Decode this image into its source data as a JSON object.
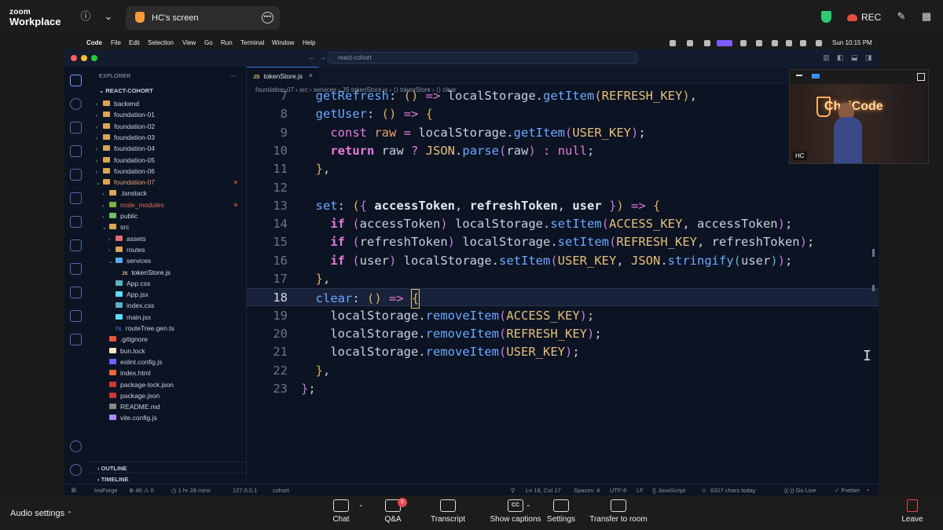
{
  "zoom": {
    "brand_line1": "zoom",
    "brand_line2": "Workplace",
    "share_tab_label": "HC's screen",
    "rec_label": "REC",
    "audio_settings": "Audio settings",
    "controls": [
      {
        "label": "Chat",
        "icon": "chat-icon"
      },
      {
        "label": "Q&A",
        "icon": "qa-icon",
        "badge": "5"
      },
      {
        "label": "Transcript",
        "icon": "transcript-icon"
      },
      {
        "label": "Show captions",
        "icon": "captions-icon",
        "icon_text": "CC"
      },
      {
        "label": "Settings",
        "icon": "gear-icon"
      },
      {
        "label": "Transfer to room",
        "icon": "transfer-icon"
      }
    ],
    "leave_label": "Leave"
  },
  "macbar": {
    "app": "Code",
    "menus": [
      "File",
      "Edit",
      "Selection",
      "View",
      "Go",
      "Run",
      "Terminal",
      "Window",
      "Help"
    ],
    "clock": "Sun 10:15 PM"
  },
  "vscode": {
    "command_center": "react-cohort",
    "explorer_title": "EXPLORER",
    "root": "REACT-COHORT",
    "tree": [
      {
        "label": "backend",
        "depth": 1,
        "type": "folder",
        "chev": "›"
      },
      {
        "label": "foundation-01",
        "depth": 1,
        "type": "folder",
        "chev": "›"
      },
      {
        "label": "foundation-02",
        "depth": 1,
        "type": "folder",
        "chev": "›"
      },
      {
        "label": "foundation-03",
        "depth": 1,
        "type": "folder",
        "chev": "›"
      },
      {
        "label": "foundation-04",
        "depth": 1,
        "type": "folder",
        "chev": "›"
      },
      {
        "label": "foundation-05",
        "depth": 1,
        "type": "folder",
        "chev": "›"
      },
      {
        "label": "foundation-06",
        "depth": 1,
        "type": "folder",
        "chev": "›"
      },
      {
        "label": "foundation-07",
        "depth": 1,
        "type": "folder-open",
        "chev": "⌄",
        "modified": true
      },
      {
        "label": ".tanstack",
        "depth": 2,
        "type": "folder",
        "chev": "›"
      },
      {
        "label": "node_modules",
        "depth": 2,
        "type": "folder-node",
        "chev": "›",
        "modified": true
      },
      {
        "label": "public",
        "depth": 2,
        "type": "folder-public",
        "chev": "›"
      },
      {
        "label": "src",
        "depth": 2,
        "type": "folder-open",
        "chev": "⌄"
      },
      {
        "label": "assets",
        "depth": 3,
        "type": "folder-assets",
        "chev": "›"
      },
      {
        "label": "routes",
        "depth": 3,
        "type": "folder-routes",
        "chev": "›"
      },
      {
        "label": "services",
        "depth": 3,
        "type": "folder-services",
        "chev": "⌄"
      },
      {
        "label": "tokenStore.js",
        "depth": 4,
        "type": "file-js",
        "icon_text": "JS"
      },
      {
        "label": "App.css",
        "depth": 3,
        "type": "file-css"
      },
      {
        "label": "App.jsx",
        "depth": 3,
        "type": "file-jsx"
      },
      {
        "label": "index.css",
        "depth": 3,
        "type": "file-css"
      },
      {
        "label": "main.jsx",
        "depth": 3,
        "type": "file-jsx"
      },
      {
        "label": "routeTree.gen.ts",
        "depth": 3,
        "type": "file-ts",
        "icon_text": "TS"
      },
      {
        "label": ".gitignore",
        "depth": 2,
        "type": "file-git"
      },
      {
        "label": "bun.lock",
        "depth": 2,
        "type": "file-bun"
      },
      {
        "label": "eslint.config.js",
        "depth": 2,
        "type": "file-eslint"
      },
      {
        "label": "index.html",
        "depth": 2,
        "type": "file-html"
      },
      {
        "label": "package-lock.json",
        "depth": 2,
        "type": "file-npm"
      },
      {
        "label": "package.json",
        "depth": 2,
        "type": "file-npm"
      },
      {
        "label": "README.md",
        "depth": 2,
        "type": "file-md"
      },
      {
        "label": "vite.config.js",
        "depth": 2,
        "type": "file-vite"
      }
    ],
    "outline": "OUTLINE",
    "timeline": "TIMELINE",
    "tab": {
      "label": "tokenStore.js",
      "icon_text": "JS",
      "close": "×"
    },
    "breadcrumb": "foundation-07 › src › services › JS tokenStore.js › ⟨⟩ tokenStore › ⟨⟩ clear",
    "code_lines": [
      {
        "n": "7",
        "html": "  <span class='f'>getRefresh</span><span class='v'>: </span><span class='g1'>()</span><span class='k'> =&gt; </span><span class='v'>localStorage.</span><span class='f'>getItem</span><span class='g1'>(</span><span class='c'>REFRESH_KEY</span><span class='g1'>)</span><span class='v'>,</span>"
      },
      {
        "n": "8",
        "html": "  <span class='f'>getUser</span><span class='v'>: </span><span class='g1'>()</span><span class='k'> =&gt; </span><span class='g1'>{</span>"
      },
      {
        "n": "9",
        "html": "    <span class='k'>const</span><span class='p'> raw </span><span class='k'>= </span><span class='v'>localStorage.</span><span class='f'>getItem</span><span class='g2'>(</span><span class='c'>USER_KEY</span><span class='g2'>)</span><span class='v'>;</span>"
      },
      {
        "n": "10",
        "html": "    <span class='kb'>return</span><span class='v'> raw </span><span class='k'>?</span><span class='c'> JSON</span><span class='v'>.</span><span class='f'>parse</span><span class='g2'>(</span><span class='v'>raw</span><span class='g2'>)</span><span class='k'> : </span><span class='k'>null</span><span class='v'>;</span>"
      },
      {
        "n": "11",
        "html": "  <span class='g1'>}</span><span class='v'>,</span>"
      },
      {
        "n": "12",
        "html": ""
      },
      {
        "n": "13",
        "html": "  <span class='f'>set</span><span class='v'>: </span><span class='g1'>(</span><span class='g2'>{</span><span class='pb'> accessToken</span><span class='v'>, </span><span class='pb'>refreshToken</span><span class='v'>, </span><span class='pb'>user</span><span class='g2'> }</span><span class='g1'>)</span><span class='k'> =&gt; </span><span class='g1'>{</span>"
      },
      {
        "n": "14",
        "html": "    <span class='kb'>if</span><span class='g2'> (</span><span class='v'>accessToken</span><span class='g2'>)</span><span class='v'> localStorage.</span><span class='f'>setItem</span><span class='g2'>(</span><span class='c'>ACCESS_KEY</span><span class='v'>, accessToken</span><span class='g2'>)</span><span class='v'>;</span>"
      },
      {
        "n": "15",
        "html": "    <span class='kb'>if</span><span class='g2'> (</span><span class='v'>refreshToken</span><span class='g2'>)</span><span class='v'> localStorage.</span><span class='f'>setItem</span><span class='g2'>(</span><span class='c'>REFRESH_KEY</span><span class='v'>, refreshToken</span><span class='g2'>)</span><span class='v'>;</span>"
      },
      {
        "n": "16",
        "html": "    <span class='kb'>if</span><span class='g2'> (</span><span class='v'>user</span><span class='g2'>)</span><span class='v'> localStorage.</span><span class='f'>setItem</span><span class='g2'>(</span><span class='c'>USER_KEY</span><span class='v'>, </span><span class='c'>JSON</span><span class='v'>.</span><span class='f'>stringify</span><span class='g3'>(</span><span class='v'>user</span><span class='g3'>)</span><span class='g2'>)</span><span class='v'>;</span>"
      },
      {
        "n": "17",
        "html": "  <span class='g1'>}</span><span class='v'>,</span>"
      },
      {
        "n": "18",
        "html": "  <span class='f'>clear</span><span class='v'>: </span><span class='g1'>()</span><span class='k'> =&gt; </span><span class='g1 cursor-block'>{</span>",
        "current": true
      },
      {
        "n": "19",
        "html": "    <span class='v'>localStorage.</span><span class='f'>removeItem</span><span class='g2'>(</span><span class='c'>ACCESS_KEY</span><span class='g2'>)</span><span class='v'>;</span>"
      },
      {
        "n": "20",
        "html": "    <span class='v'>localStorage.</span><span class='f'>removeItem</span><span class='g2'>(</span><span class='c'>REFRESH_KEY</span><span class='g2'>)</span><span class='v'>;</span>"
      },
      {
        "n": "21",
        "html": "    <span class='v'>localStorage.</span><span class='f'>removeItem</span><span class='g2'>(</span><span class='c'>USER_KEY</span><span class='g2'>)</span><span class='v'>;</span>"
      },
      {
        "n": "22",
        "html": "  <span class='g1'>}</span><span class='v'>,</span>"
      },
      {
        "n": "23",
        "html": "<span class='g2'>}</span><span class='v'>;</span>"
      }
    ],
    "status": {
      "remote": "⌘",
      "profile": "InsForge",
      "problems": "⊗ 40 ⚠ 0",
      "time": "◷ 1 hr 28 mins",
      "host": "127.0.0.1",
      "branch": "cohort",
      "position": "Ln 18, Col 17",
      "spaces": "Spaces: 4",
      "encoding": "UTF-8",
      "eol": "LF",
      "language": "{} JavaScript",
      "chars": "6327 chars today",
      "golive": "((·)) Go Live",
      "prettier": "✓ Prettier"
    }
  },
  "cam": {
    "name": "HC",
    "sign_text": "ChaiCode"
  },
  "colors": {
    "accent": "#3b79d4",
    "leave": "#e5484d",
    "shield": "#2ecc71"
  }
}
